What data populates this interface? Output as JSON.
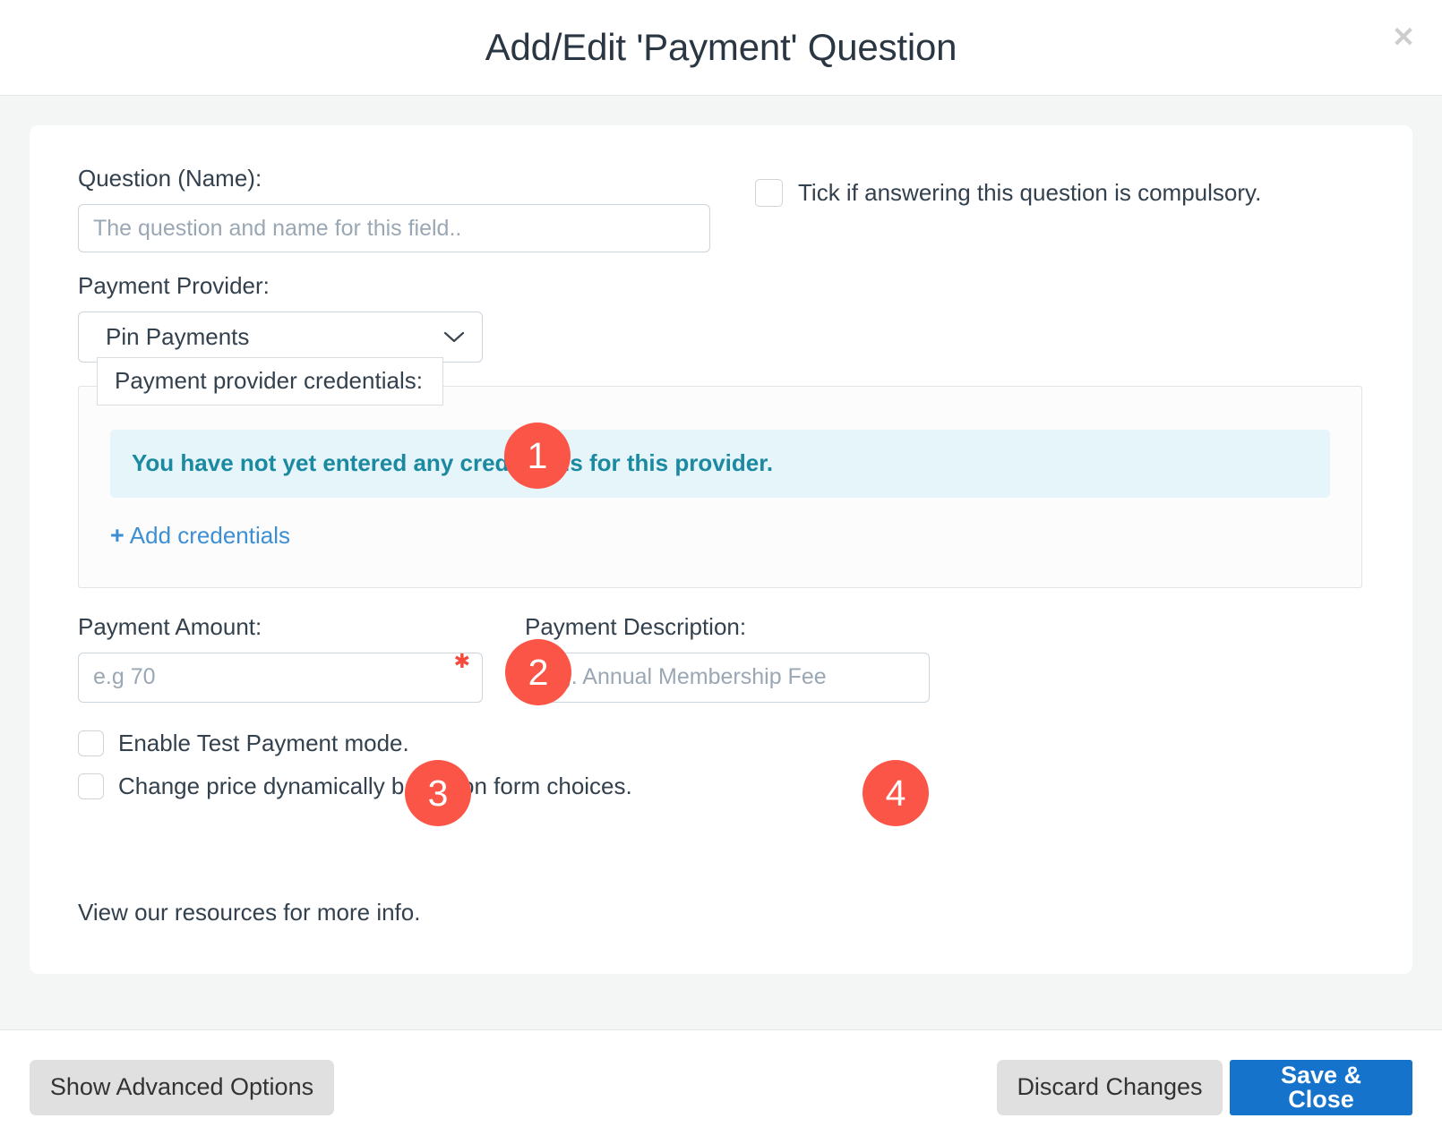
{
  "header": {
    "title": "Add/Edit 'Payment' Question",
    "close_label": "✕"
  },
  "form": {
    "question_label": "Question (Name):",
    "question_placeholder": "The question and name for this field..",
    "question_value": "",
    "compulsory_label": "Tick if answering this question is compulsory.",
    "provider_label": "Payment Provider:",
    "provider_value": "Pin Payments",
    "credentials": {
      "legend": "Payment provider credentials:",
      "alert_text": "You have not yet entered any credentials for this provider.",
      "add_link": "Add credentials",
      "add_icon": "+"
    },
    "amount_label": "Payment Amount:",
    "amount_placeholder": "e.g 70",
    "amount_value": "",
    "description_label": "Payment Description:",
    "description_placeholder": "e.g. Annual Membership Fee",
    "description_value": "",
    "test_mode_label": "Enable Test Payment mode.",
    "dynamic_price_label": "Change price dynamically based on form choices.",
    "resources_note": "View our resources for more info."
  },
  "badges": {
    "one": "1",
    "two": "2",
    "three": "3",
    "four": "4"
  },
  "footer": {
    "advanced_label": "Show Advanced Options",
    "discard_label": "Discard Changes",
    "save_label": "Save & Close"
  },
  "colors": {
    "badge": "#fb5548",
    "primary": "#1573cc",
    "link": "#3d8fd3",
    "alert_bg": "#e5f5fa",
    "alert_text": "#1b89a0",
    "body_bg": "#f4f6f6"
  }
}
